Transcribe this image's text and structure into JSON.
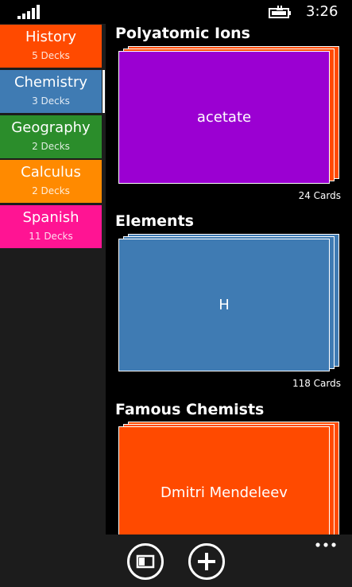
{
  "status_bar": {
    "time": "3:26",
    "signal_icon": "signal-bars-icon",
    "battery_icon": "battery-charging-icon"
  },
  "sidebar": {
    "items": [
      {
        "name": "History",
        "count": "5 Decks",
        "color": "#ff4a00",
        "selected": false
      },
      {
        "name": "Chemistry",
        "count": "3 Decks",
        "color": "#3f7bb3",
        "selected": true
      },
      {
        "name": "Geography",
        "count": "2 Decks",
        "color": "#2b8d2b",
        "selected": false
      },
      {
        "name": "Calculus",
        "count": "2 Decks",
        "color": "#ff8a00",
        "selected": false
      },
      {
        "name": "Spanish",
        "count": "11 Decks",
        "color": "#ff1493",
        "selected": false
      }
    ]
  },
  "main": {
    "decks": [
      {
        "title": "Polyatomic Ions",
        "card_text": "acetate",
        "count": "24  Cards",
        "color": "#9b00d2",
        "back_color": "#ff4a00"
      },
      {
        "title": "Elements",
        "card_text": "H",
        "count": "118  Cards",
        "color": "#3f7bb3",
        "back_color": "#3f7bb3"
      },
      {
        "title": "Famous Chemists",
        "card_text": "Dmitri Mendeleev",
        "count": "",
        "color": "#ff4a00",
        "back_color": "#ff4a00"
      }
    ]
  },
  "app_bar": {
    "buttons": [
      {
        "icon": "sidebar-toggle-icon"
      },
      {
        "icon": "add-icon"
      }
    ],
    "more_icon": "more-icon"
  }
}
